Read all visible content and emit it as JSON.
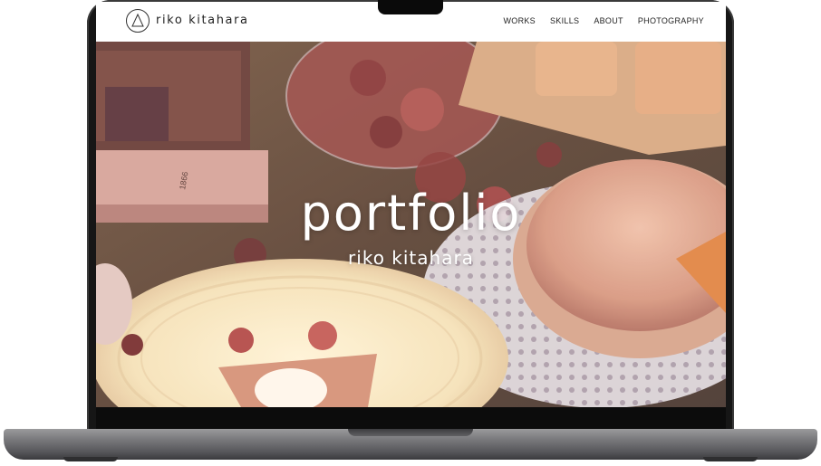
{
  "site": {
    "logo_text": "riko kitahara"
  },
  "nav": {
    "items": [
      {
        "label": "WORKS"
      },
      {
        "label": "SKILLS"
      },
      {
        "label": "ABOUT"
      },
      {
        "label": "PHOTOGRAPHY"
      }
    ]
  },
  "hero": {
    "title": "portfolio",
    "subtitle": "riko kitahara",
    "book_spine_text": "1866"
  },
  "colors": {
    "nav_background": "#ffffff",
    "hero_text": "#ffffff",
    "laptop_bezel": "#161616",
    "laptop_body": "#7d7d80"
  }
}
